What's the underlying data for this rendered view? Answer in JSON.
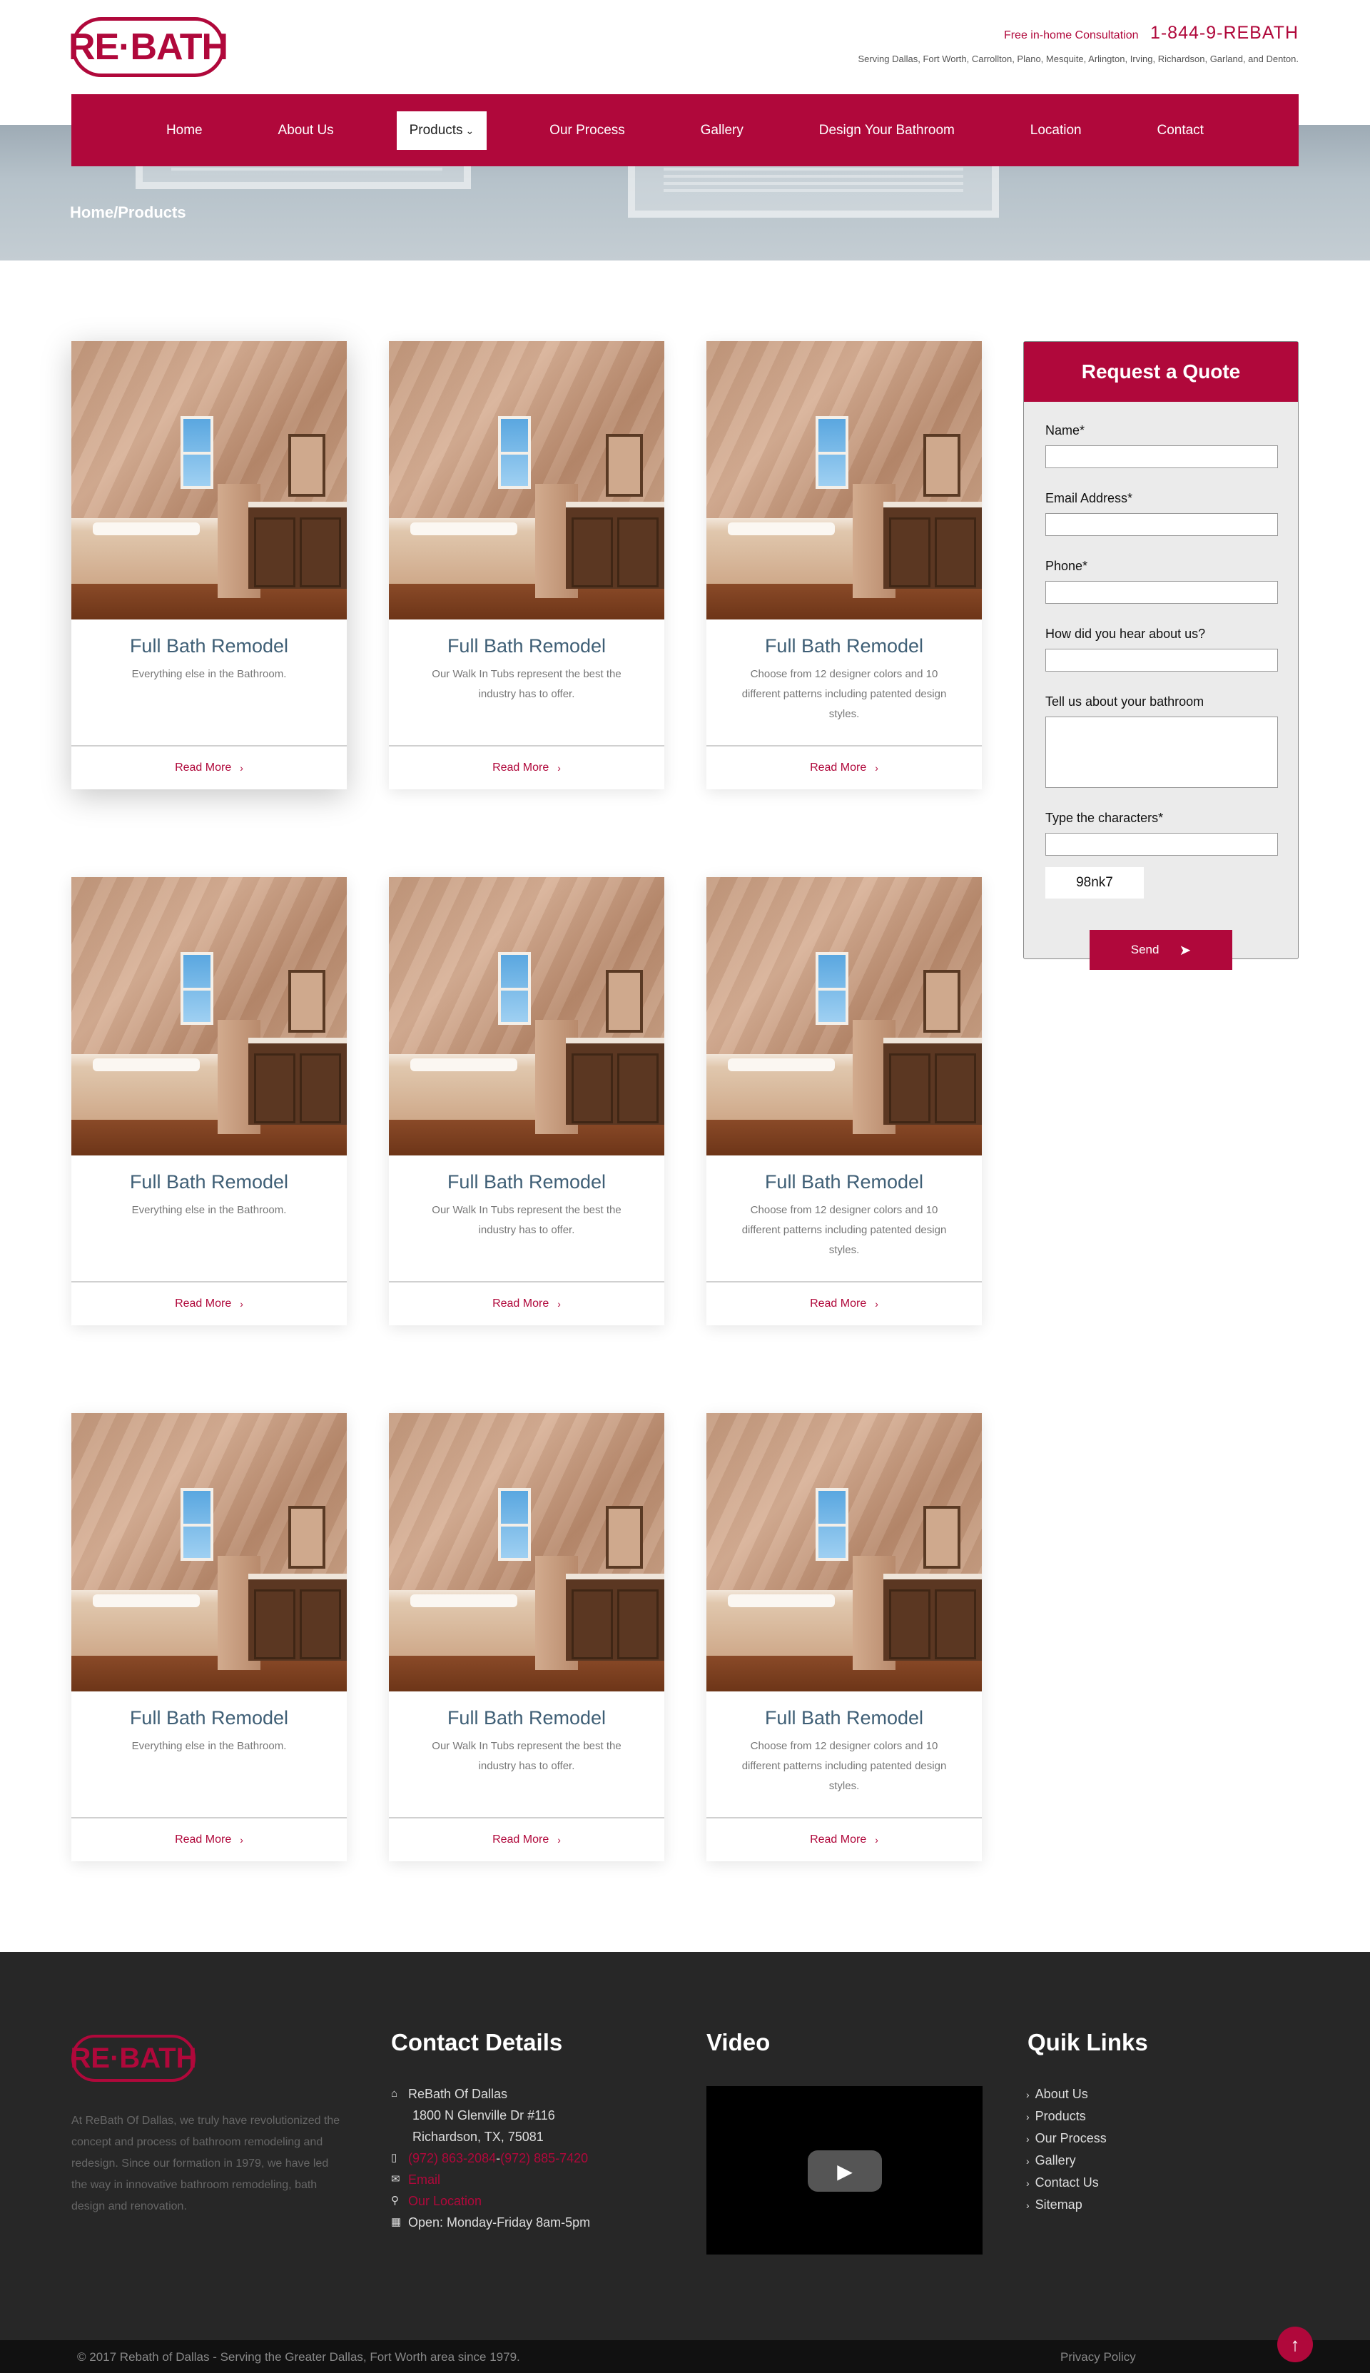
{
  "brand": {
    "logo_text": "RE·BATH",
    "accent": "#b0083b"
  },
  "header": {
    "consult_label": "Free in-home Consultation",
    "phone": "1-844-9-REBATH",
    "serving": "Serving Dallas, Fort Worth, Carrollton, Plano, Mesquite, Arlington, Irving, Richardson, Garland, and Denton."
  },
  "nav": {
    "items": [
      "Home",
      "About Us",
      "Products",
      "Our Process",
      "Gallery",
      "Design Your Bathroom",
      "Location",
      "Contact"
    ],
    "active": "Products"
  },
  "breadcrumb": "Home/Products",
  "products": [
    {
      "title": "Full Bath Remodel",
      "desc": "Everything else in the Bathroom.",
      "link": "Read More"
    },
    {
      "title": "Full Bath Remodel",
      "desc": "Our Walk In Tubs represent the best the industry has to offer.",
      "link": "Read More"
    },
    {
      "title": "Full Bath Remodel",
      "desc": "Choose from 12 designer colors and 10 different patterns including patented design styles.",
      "link": "Read More"
    },
    {
      "title": "Full Bath Remodel",
      "desc": "Everything else in the Bathroom.",
      "link": "Read More"
    },
    {
      "title": "Full Bath Remodel",
      "desc": "Our Walk In Tubs represent the best the industry has to offer.",
      "link": "Read More"
    },
    {
      "title": "Full Bath Remodel",
      "desc": "Choose from 12 designer colors and 10 different patterns including patented design styles.",
      "link": "Read More"
    },
    {
      "title": "Full Bath Remodel",
      "desc": "Everything else in the Bathroom.",
      "link": "Read More"
    },
    {
      "title": "Full Bath Remodel",
      "desc": "Our Walk In Tubs represent the best the industry has to offer.",
      "link": "Read More"
    },
    {
      "title": "Full Bath Remodel",
      "desc": "Choose from 12 designer colors and 10 different patterns including patented design styles.",
      "link": "Read More"
    }
  ],
  "quote": {
    "title": "Request a Quote",
    "name_label": "Name*",
    "email_label": "Email Address*",
    "phone_label": "Phone*",
    "hear_label": "How did you hear about us?",
    "bathroom_label": "Tell us about your bathroom",
    "captcha_label": "Type the characters*",
    "captcha_value": "98nk7",
    "send_label": "Send"
  },
  "footer": {
    "logo_text": "RE·BATH",
    "about": "At ReBath Of Dallas, we truly have revolutionized the concept and process of bathroom remodeling and redesign. Since our formation in 1979, we have led the way in innovative bathroom remodeling, bath design and renovation.",
    "contact_heading": "Contact Details",
    "company": "ReBath Of Dallas",
    "address1": "1800 N Glenville Dr #116",
    "address2": "Richardson, TX, 75081",
    "phone1": "(972) 863-2084",
    "phone_sep": " - ",
    "phone2": "(972) 885-7420",
    "email": "Email",
    "location": "Our Location",
    "hours": "Open: Monday-Friday 8am-5pm",
    "video_heading": "Video",
    "links_heading": "Quik Links",
    "links": [
      "About Us",
      "Products",
      "Our Process",
      "Gallery",
      "Contact Us",
      "Sitemap"
    ],
    "copyright": "© 2017 Rebath of Dallas - Serving the Greater Dallas, Fort Worth area since 1979.",
    "privacy": "Privacy Policy"
  }
}
